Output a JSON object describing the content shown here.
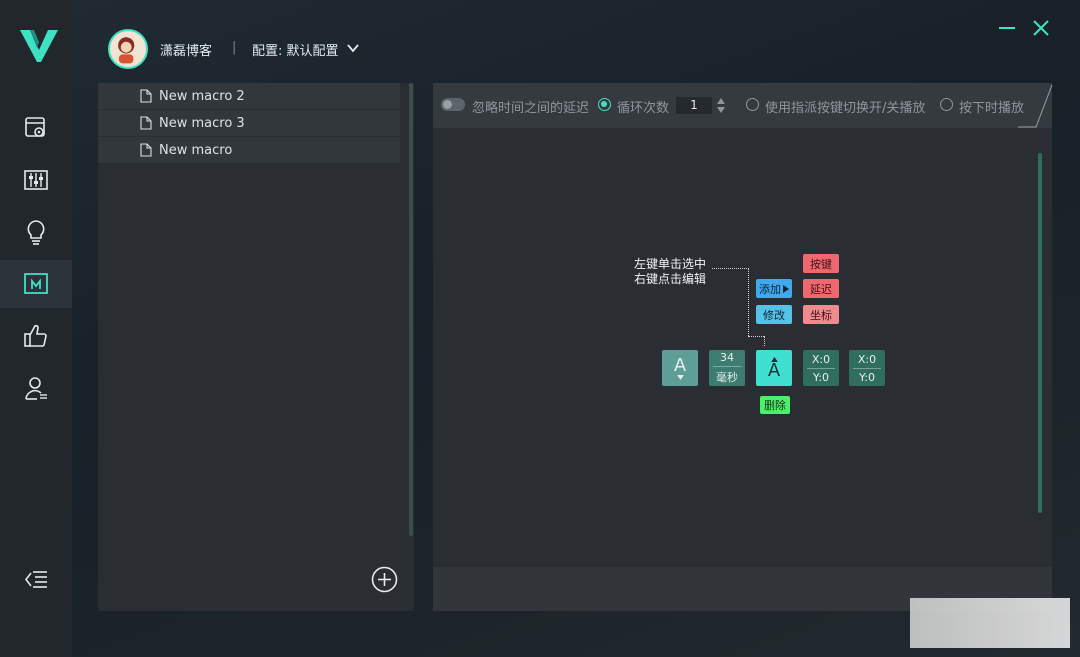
{
  "header": {
    "user_name": "潇磊博客",
    "separator": "|",
    "config_label": "配置: 默认配置"
  },
  "sidebar": {
    "items": [
      {
        "icon": "mouse-settings-icon"
      },
      {
        "icon": "equalizer-icon"
      },
      {
        "icon": "lightbulb-icon"
      },
      {
        "icon": "macro-icon",
        "active": true
      },
      {
        "icon": "thumbs-up-icon"
      },
      {
        "icon": "user-icon"
      }
    ],
    "collapse_icon": "collapse-menu-icon"
  },
  "macro_list": {
    "items": [
      {
        "label": "New macro 2"
      },
      {
        "label": "New macro 3"
      },
      {
        "label": "New macro"
      }
    ]
  },
  "toolbar": {
    "ignore_delay_label": "忽略时间之间的延迟",
    "loop_label": "循环次数",
    "loop_count": "1",
    "toggle_key_label": "使用指派按键切换开/关播放",
    "press_play_label": "按下时播放"
  },
  "demo": {
    "hint_line1": "左键单击选中",
    "hint_line2": "右键点击编辑",
    "add_label": "添加",
    "modify_label": "修改",
    "key_label": "按键",
    "delay_label": "延迟",
    "coord_label": "坐标",
    "delete_label": "删除",
    "tile_key": "A",
    "tile_delay_value": "34",
    "tile_delay_unit": "毫秒",
    "tile_selected_key": "A",
    "tile_x": "X:0",
    "tile_y": "Y:0",
    "tile2_x": "X:0",
    "tile2_y": "Y:0"
  },
  "colors": {
    "accent": "#3fe0c4",
    "add_button": "#40a9ee",
    "key_button": "#f0686f",
    "delete_button": "#4df06a"
  }
}
